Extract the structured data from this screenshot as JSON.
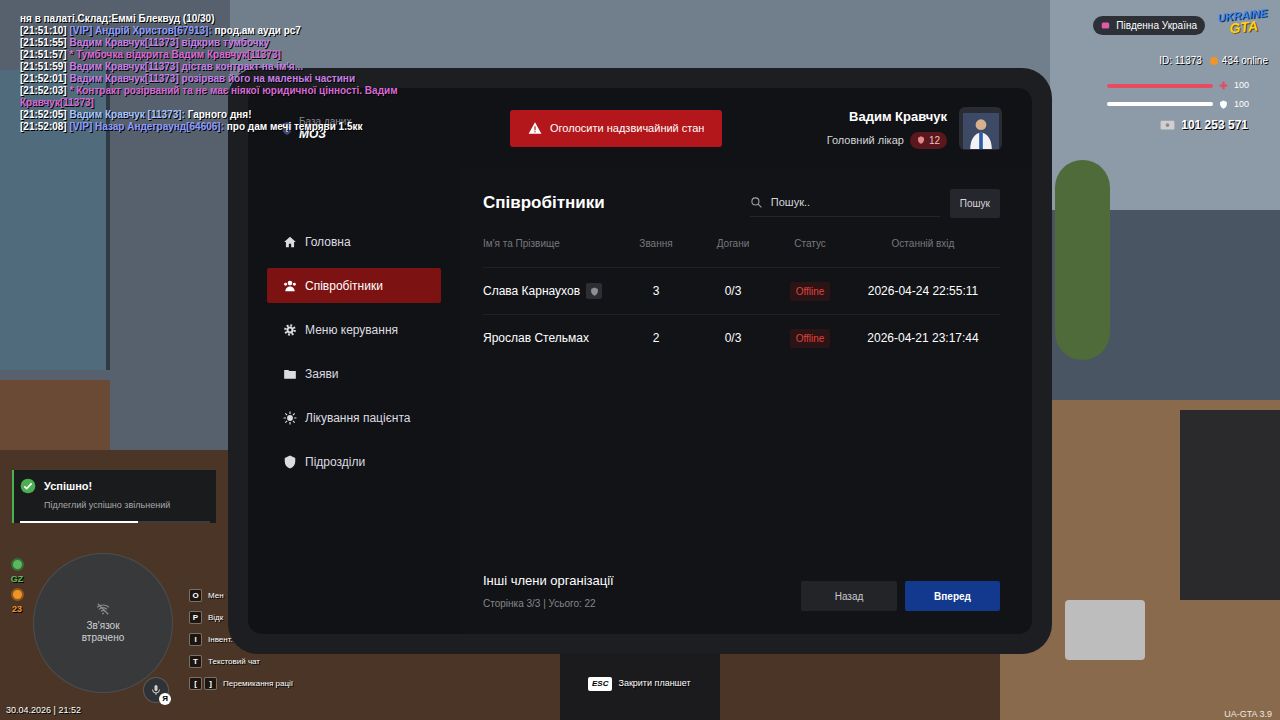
{
  "chat": [
    {
      "segments": [
        {
          "text": "ня в палаті.Склад:Еммі Блеквуд (10/30)",
          "color": "#ffffff"
        }
      ]
    },
    {
      "segments": [
        {
          "text": "[21:51:10] ",
          "color": "#ffffff"
        },
        {
          "text": "[VIP] Андрій Христов[67913]:",
          "color": "#8f9cff"
        },
        {
          "text": " прод.ам ауди рс7",
          "color": "#ffffff"
        }
      ]
    },
    {
      "segments": [
        {
          "text": "[21:51:55] ",
          "color": "#ffffff"
        },
        {
          "text": "Вадим Кравчук[11373] відкрив тумбочку",
          "color": "#c880e8"
        }
      ]
    },
    {
      "segments": [
        {
          "text": "[21:51:57] ",
          "color": "#ffffff"
        },
        {
          "text": "* Тумбочка відкрита Вадим Кравчук[11373]",
          "color": "#d96ad6"
        }
      ]
    },
    {
      "segments": [
        {
          "text": "[21:51:59] ",
          "color": "#ffffff"
        },
        {
          "text": "Вадим Кравчук[11373] дістав контракт на ім'я...",
          "color": "#c880e8"
        }
      ]
    },
    {
      "segments": [
        {
          "text": "[21:52:01] ",
          "color": "#ffffff"
        },
        {
          "text": "Вадим Кравчук[11373] розірвав його на маленькі частини",
          "color": "#c880e8"
        }
      ]
    },
    {
      "segments": [
        {
          "text": "[21:52:03] ",
          "color": "#ffffff"
        },
        {
          "text": "* Контракт розірваний та не має ніякої юридичної цінності. Вадим Кравчук[11373]",
          "color": "#d96ad6"
        }
      ]
    },
    {
      "segments": [
        {
          "text": "[21:52:05] ",
          "color": "#ffffff"
        },
        {
          "text": "Вадим Кравчук [11373]:",
          "color": "#a8c4ff"
        },
        {
          "text": " Гарного дня!",
          "color": "#ffffff"
        }
      ]
    },
    {
      "segments": [
        {
          "text": "[21:52:08] ",
          "color": "#ffffff"
        },
        {
          "text": "[VIP] Назар Андеграунд[64606]:",
          "color": "#8f9cff"
        },
        {
          "text": " про дам мечі темряви 1.5кк",
          "color": "#ffffff"
        }
      ]
    }
  ],
  "hud": {
    "server": "Південна Україна",
    "logo": {
      "top": "UKRAINE",
      "bottom": "GTA"
    },
    "id": "ID: 11373",
    "online": "434 online",
    "health": {
      "value": "100",
      "level": 1
    },
    "armor": {
      "value": "100",
      "level": 1
    },
    "money": "101 253 571"
  },
  "tablet": {
    "logo": {
      "subtitle": "База даних",
      "title": "МОЗ"
    },
    "emergency_button": "Оголосити надзвичайний стан",
    "user": {
      "name": "Вадим Кравчук",
      "rank": "Головний лікар",
      "level": "12"
    },
    "sidebar": [
      {
        "label": "Головна",
        "kind": "home",
        "selected": false
      },
      {
        "label": "Співробітники",
        "kind": "people",
        "selected": true
      },
      {
        "label": "Меню керування",
        "kind": "gear",
        "selected": false
      },
      {
        "label": "Заяви",
        "kind": "folder",
        "selected": false
      },
      {
        "label": "Лікування пацієнта",
        "kind": "sun",
        "selected": false
      },
      {
        "label": "Підрозділи",
        "kind": "shield",
        "selected": false
      }
    ],
    "title": "Співробітники",
    "search": {
      "placeholder": "Пошук..",
      "button": "Пошук"
    },
    "table": {
      "columns": [
        "Ім'я та Прізвище",
        "Звання",
        "Догани",
        "Статус",
        "Останній вхід"
      ],
      "rows": [
        {
          "name": "Слава Карнаухов",
          "badge": true,
          "rank": "3",
          "warnings": "0/3",
          "status": "Offline",
          "online": false,
          "last_login": "2026-04-24 22:55:11"
        },
        {
          "name": "Ярослав Стельмах",
          "badge": false,
          "rank": "2",
          "warnings": "0/3",
          "status": "Offline",
          "online": false,
          "last_login": "2026-04-21 23:17:44"
        }
      ]
    },
    "footer": {
      "title": "Інші члени організації",
      "info": "Сторінка 3/3 | Усього: 22",
      "prev": "Назад",
      "next": "Вперед"
    }
  },
  "notification": {
    "title": "Успішно!",
    "message": "Підлеглий успішно звільнений",
    "level": 0.62
  },
  "minimap": {
    "status": "Зв'язок втрачено",
    "indicators": [
      {
        "label": "GZ",
        "color": "#5cb85c"
      },
      {
        "label": "23",
        "color": "#f0932b"
      }
    ]
  },
  "datetime": "30.04.2026 | 21:52",
  "hotkeys": [
    {
      "keys": [
        "O"
      ],
      "label": "Мен"
    },
    {
      "keys": [
        "P"
      ],
      "label": "Відк"
    },
    {
      "keys": [
        "I"
      ],
      "label": "Інвент."
    },
    {
      "keys": [
        "T"
      ],
      "label": "Текстовий чат"
    },
    {
      "keys": [
        "[",
        "]"
      ],
      "label": "Перемикання рації"
    }
  ],
  "voice": {
    "badge": "Я"
  },
  "close_hint": {
    "key": "ESC",
    "label": "Закрити планшет"
  },
  "version": "UA-GTA 3.9"
}
